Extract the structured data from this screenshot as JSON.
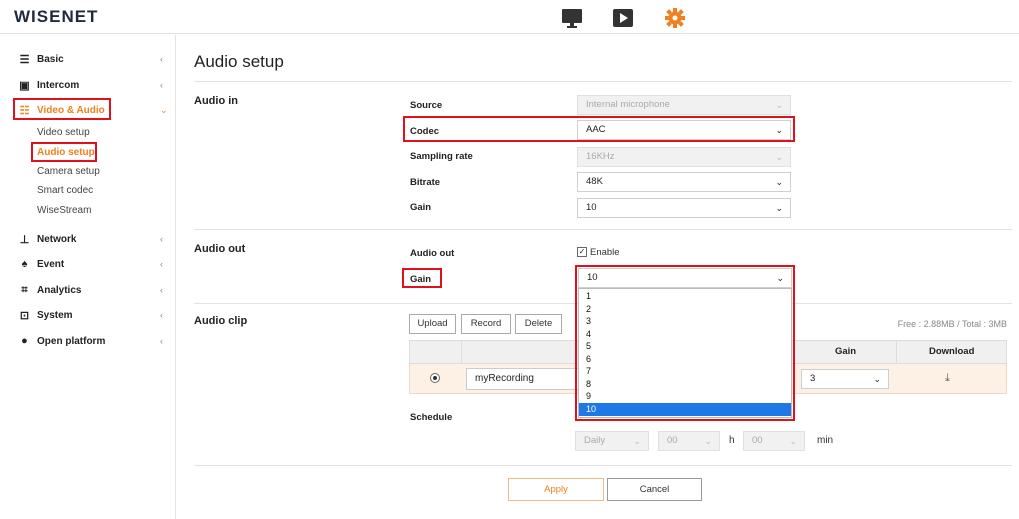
{
  "header": {
    "logo": "WISENET",
    "icons": [
      "monitor-icon",
      "play-icon",
      "gear-icon"
    ],
    "accent": "#f08020"
  },
  "sidebar": {
    "items": [
      {
        "label": "Basic",
        "icon": "list-icon"
      },
      {
        "label": "Intercom",
        "icon": "intercom-icon"
      },
      {
        "label": "Video & Audio",
        "icon": "sliders-icon",
        "active": true
      },
      {
        "label": "Network",
        "icon": "network-icon"
      },
      {
        "label": "Event",
        "icon": "bell-icon"
      },
      {
        "label": "Analytics",
        "icon": "analytics-icon"
      },
      {
        "label": "System",
        "icon": "system-icon"
      },
      {
        "label": "Open platform",
        "icon": "platform-icon"
      }
    ],
    "subitems": [
      "Video setup",
      "Audio setup",
      "Camera setup",
      "Smart codec",
      "WiseStream"
    ]
  },
  "page": {
    "title": "Audio setup"
  },
  "audio_in": {
    "label": "Audio in",
    "source": {
      "label": "Source",
      "value": "Internal microphone"
    },
    "codec": {
      "label": "Codec",
      "value": "AAC"
    },
    "sampling": {
      "label": "Sampling rate",
      "value": "16KHz"
    },
    "bitrate": {
      "label": "Bitrate",
      "value": "48K"
    },
    "gain": {
      "label": "Gain",
      "value": "10"
    }
  },
  "audio_out": {
    "label": "Audio out",
    "field_label": "Audio out",
    "enable_label": "Enable",
    "gain_label": "Gain",
    "gain_value": "10",
    "gain_options": [
      "1",
      "2",
      "3",
      "4",
      "5",
      "6",
      "7",
      "8",
      "9",
      "10"
    ]
  },
  "audio_clip": {
    "label": "Audio clip",
    "buttons": {
      "upload": "Upload",
      "record": "Record",
      "delete": "Delete"
    },
    "storage": "Free : 2.88MB / Total : 3MB",
    "columns": {
      "gain": "Gain",
      "download": "Download"
    },
    "row": {
      "name": "myRecording",
      "gain": "3"
    }
  },
  "schedule": {
    "label": "Schedule",
    "period": "Daily",
    "hour": "00",
    "h": "h",
    "minute": "00",
    "min": "min"
  },
  "footer": {
    "apply": "Apply",
    "cancel": "Cancel"
  }
}
